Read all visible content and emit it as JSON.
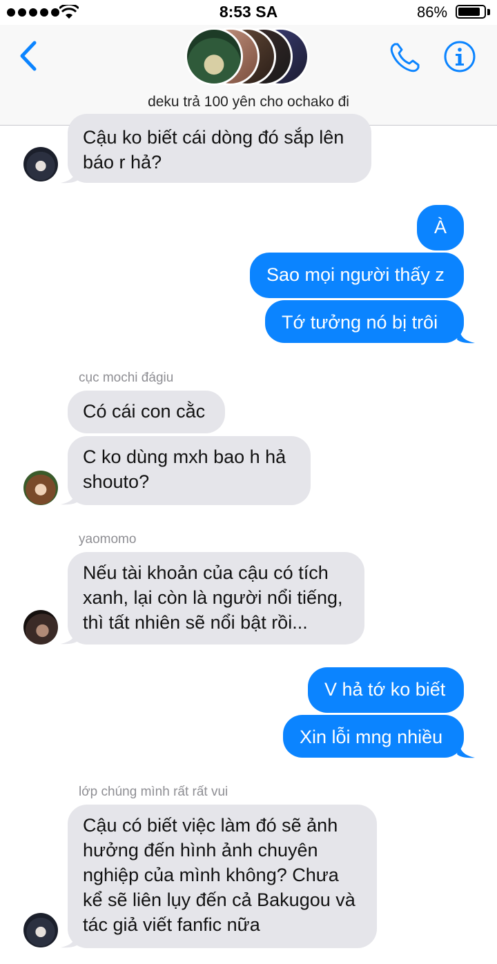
{
  "status_bar": {
    "time": "8:53 SA",
    "battery_percent": "86%",
    "battery_level": 0.86
  },
  "header": {
    "group_name": "deku trả 100 yên cho ochako đi"
  },
  "messages": {
    "m1": "Cậu ko biết cái dòng đó sắp lên báo r hả?",
    "m2": "À",
    "m3": "Sao mọi người thấy z",
    "m4": "Tớ tưởng nó bị trôi r",
    "sender2": "cục mochi đágiu",
    "m5": "Có cái con cằc",
    "m6": "C ko dùng mxh bao h hả shouto?",
    "sender3": "yaomomo",
    "m7": "Nếu tài khoản của cậu có tích xanh, lại còn là người nổi tiếng, thì tất nhiên sẽ nổi bật rồi...",
    "m8": "V hả tớ ko biết",
    "m9": "Xin lỗi mng nhiều",
    "sender4": "lớp chúng mình rất rất vui",
    "m10": "Cậu có biết việc làm đó sẽ ảnh hưởng đến hình ảnh chuyên nghiệp của mình không? Chưa kể sẽ liên lụy đến cả Bakugou và tác giả viết fanfic nữa"
  },
  "colors": {
    "accent": "#0b84ff",
    "incoming_bubble": "#e5e5ea",
    "header_bg": "#f8f8f8"
  },
  "icons": {
    "back": "chevron-left-icon",
    "call": "phone-icon",
    "info": "info-icon"
  }
}
